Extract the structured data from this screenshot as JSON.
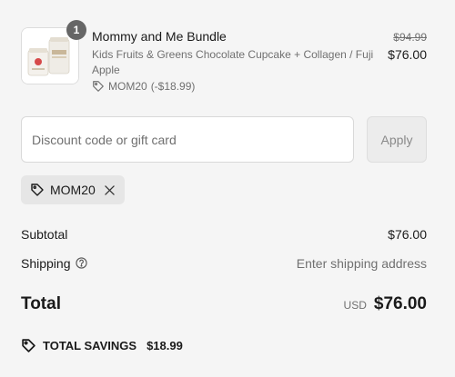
{
  "product": {
    "quantity": "1",
    "title": "Mommy and Me Bundle",
    "variant": "Kids Fruits & Greens Chocolate Cupcake + Collagen / Fuji Apple",
    "discount_code": "MOM20",
    "discount_amount": "(-$18.99)",
    "compare_price": "$94.99",
    "price": "$76.00",
    "image_icon": "product-thumbnail"
  },
  "discount": {
    "placeholder": "Discount code or gift card",
    "value": "",
    "apply_label": "Apply",
    "applied_code": "MOM20",
    "remove_icon": "close-icon",
    "tag_icon": "tag-icon"
  },
  "summary": {
    "subtotal_label": "Subtotal",
    "subtotal_value": "$76.00",
    "shipping_label": "Shipping",
    "shipping_help_icon": "help-circle-icon",
    "shipping_value": "Enter shipping address",
    "total_label": "Total",
    "currency": "USD",
    "total_value": "$76.00",
    "savings_label": "TOTAL SAVINGS",
    "savings_value": "$18.99"
  },
  "colors": {
    "background": "#f5f5f5",
    "text": "#1a1a1a",
    "muted": "#707070",
    "badge": "#666666",
    "chip": "#e6e6e6"
  }
}
